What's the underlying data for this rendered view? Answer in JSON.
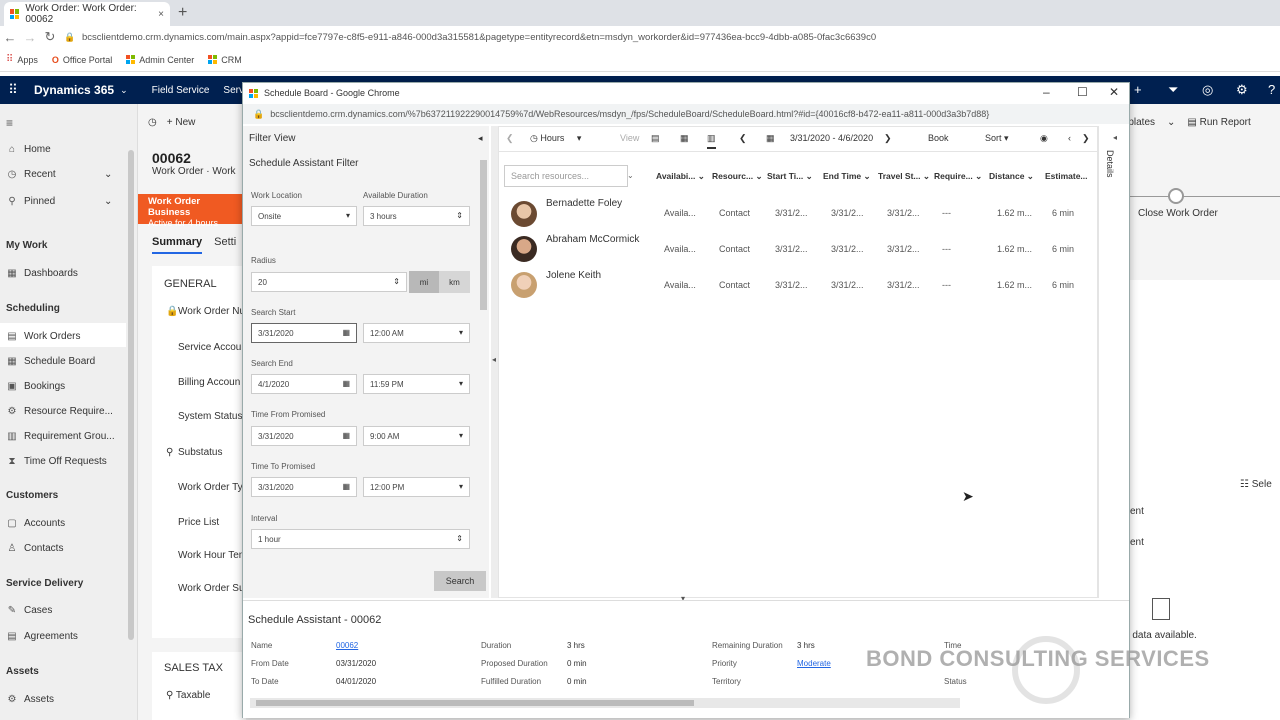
{
  "browser": {
    "tab_title": "Work Order: Work Order: 00062",
    "tab_close": "×",
    "new_tab": "+",
    "url": "bcsclientdemo.crm.dynamics.com/main.aspx?appid=fce7797e-c8f5-e911-a846-000d3a315581&pagetype=entityrecord&etn=msdyn_workorder&id=977436ea-bcc9-4dbb-a085-0fac3c6639c0",
    "bookmarks": [
      "Apps",
      "Office Portal",
      "Admin Center",
      "CRM"
    ]
  },
  "dynamics": {
    "brand": "Dynamics 365",
    "area": "Field Service",
    "area2": "Service"
  },
  "leftnav": {
    "items_top": [
      {
        "label": "Home",
        "icon": "home-icon"
      },
      {
        "label": "Recent",
        "icon": "clock-icon"
      },
      {
        "label": "Pinned",
        "icon": "pin-icon"
      }
    ],
    "section_mywork": "My Work",
    "dashboards": "Dashboards",
    "section_scheduling": "Scheduling",
    "scheduling_items": [
      "Work Orders",
      "Schedule Board",
      "Bookings",
      "Resource Require...",
      "Requirement Grou...",
      "Time Off Requests"
    ],
    "section_customers": "Customers",
    "customer_items": [
      "Accounts",
      "Contacts"
    ],
    "section_service": "Service Delivery",
    "service_items": [
      "Cases",
      "Agreements"
    ],
    "section_assets": "Assets",
    "asset_items": [
      "Assets"
    ]
  },
  "record": {
    "new_label": "New",
    "number": "00062",
    "subtitle": "Work Order · Work",
    "bpf_title": "Work Order Business",
    "bpf_sub": "Active for 4 hours",
    "tabs": [
      "Summary",
      "Setti"
    ],
    "general": "GENERAL",
    "fields": [
      "Work Order Nu",
      "Service Accou",
      "Billing Accoun",
      "System Status",
      "Substatus",
      "Work Order Ty",
      "Price List",
      "Work Hour Ten",
      "Work Order Su"
    ],
    "sales_tax": "SALES TAX",
    "taxable": "Taxable",
    "right_cmd": [
      "mplates",
      "Run Report"
    ],
    "stage": "Close Work Order",
    "right_texts": [
      "Sele",
      "ent",
      "ent"
    ],
    "no_data": "o data available."
  },
  "popup": {
    "title": "Schedule Board - Google Chrome",
    "url": "bcsclientdemo.crm.dynamics.com/%7b637211922290014759%7d/WebResources/msdyn_/fps/ScheduleBoard/ScheduleBoard.html?#id={40016cf8-b472-ea11-a811-000d3a3b7d88}"
  },
  "filter": {
    "title": "Filter View",
    "subtitle": "Schedule Assistant Filter",
    "work_location_label": "Work Location",
    "work_location_value": "Onsite",
    "available_duration_label": "Available Duration",
    "available_duration_value": "3 hours",
    "radius_label": "Radius",
    "radius_value": "20",
    "unit_mi": "mi",
    "unit_km": "km",
    "search_start_label": "Search Start",
    "search_start_date": "3/31/2020",
    "search_start_time": "12:00 AM",
    "search_end_label": "Search End",
    "search_end_date": "4/1/2020",
    "search_end_time": "11:59 PM",
    "time_from_label": "Time From Promised",
    "time_from_date": "3/31/2020",
    "time_from_time": "9:00 AM",
    "time_to_label": "Time To Promised",
    "time_to_date": "3/31/2020",
    "time_to_time": "12:00 PM",
    "interval_label": "Interval",
    "interval_value": "1 hour",
    "search_button": "Search"
  },
  "board": {
    "hours": "Hours",
    "view": "View",
    "date_range": "3/31/2020 - 4/6/2020",
    "book": "Book",
    "sort": "Sort",
    "search_placeholder": "Search resources...",
    "columns": [
      "Availabi...",
      "Resourc...",
      "Start Ti...",
      "End Time",
      "Travel St...",
      "Require...",
      "Distance",
      "Estimate..."
    ],
    "rows": [
      {
        "name": "Bernadette Foley",
        "avail": "Availa...",
        "resource": "Contact",
        "start": "3/31/2...",
        "end": "3/31/2...",
        "travel": "3/31/2...",
        "req": "---",
        "distance": "1.62 m...",
        "estimate": "6 min"
      },
      {
        "name": "Abraham McCormick",
        "avail": "Availa...",
        "resource": "Contact",
        "start": "3/31/2...",
        "end": "3/31/2...",
        "travel": "3/31/2...",
        "req": "---",
        "distance": "1.62 m...",
        "estimate": "6 min"
      },
      {
        "name": "Jolene Keith",
        "avail": "Availa...",
        "resource": "Contact",
        "start": "3/31/2...",
        "end": "3/31/2...",
        "travel": "3/31/2...",
        "req": "---",
        "distance": "1.62 m...",
        "estimate": "6 min"
      }
    ],
    "details": "Details"
  },
  "assistant": {
    "title": "Schedule Assistant - 00062",
    "name_label": "Name",
    "name_value": "00062",
    "from_label": "From Date",
    "from_value": "03/31/2020",
    "to_label": "To Date",
    "to_value": "04/01/2020",
    "duration_label": "Duration",
    "duration_value": "3 hrs",
    "proposed_label": "Proposed Duration",
    "proposed_value": "0 min",
    "fulfilled_label": "Fulfilled Duration",
    "fulfilled_value": "0 min",
    "remaining_label": "Remaining Duration",
    "remaining_value": "3 hrs",
    "priority_label": "Priority",
    "priority_value": "Moderate",
    "territory_label": "Territory",
    "time_label": "Time",
    "status_label": "Status"
  },
  "watermark": "BOND CONSULTING SERVICES",
  "colors": {
    "dynamics_header": "#002050",
    "bpf": "#f05a22",
    "link": "#2266e3"
  }
}
